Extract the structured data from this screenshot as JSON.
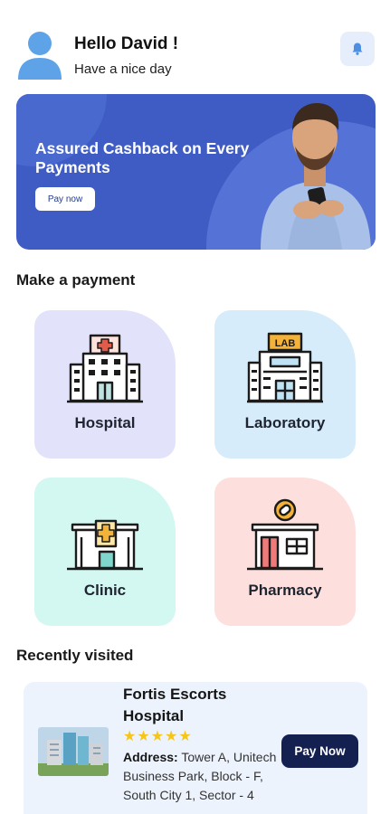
{
  "header": {
    "greeting": "Hello David !",
    "subtitle": "Have a nice day",
    "avatar_icon": "user-avatar-icon",
    "notification_icon": "bell-icon"
  },
  "banner": {
    "title": "Assured Cashback on Every Payments",
    "button_label": "Pay now"
  },
  "payment_section": {
    "title": "Make a payment",
    "categories": [
      {
        "label": "Hospital",
        "icon": "hospital-icon",
        "color": "#e3e2fb"
      },
      {
        "label": "Laboratory",
        "icon": "laboratory-icon",
        "color": "#d6ecfb"
      },
      {
        "label": "Clinic",
        "icon": "clinic-icon",
        "color": "#d3f7f1"
      },
      {
        "label": "Pharmacy",
        "icon": "pharmacy-icon",
        "color": "#fde0dd"
      }
    ],
    "lab_sign": "LAB"
  },
  "recent_section": {
    "title": "Recently visited",
    "items": [
      {
        "name": "Fortis Escorts Hospital",
        "rating_stars": "★★★★★",
        "rating": 5,
        "address_label": "Address:",
        "address": " Tower A, Unitech Business Park, Block - F, South City 1, Sector - 4",
        "button_label": "Pay Now"
      }
    ]
  },
  "colors": {
    "banner": "#3e5cc4",
    "pay_button": "#142150",
    "star": "#f5c518",
    "avatar": "#5ea3e8"
  }
}
